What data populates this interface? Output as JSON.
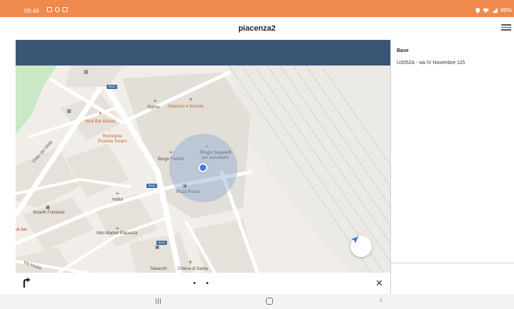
{
  "status_bar": {
    "time": "09:48",
    "battery": "99%",
    "bg_color": "#ee8a4e"
  },
  "app": {
    "title": "piacenza2",
    "menu_icon": "hamburger-menu-icon",
    "header_color": "#3b5575"
  },
  "map": {
    "labels": {
      "sigma": "Sigma",
      "deposito": "Deposito e ferrovia",
      "new_bar": "New Bar Kebab",
      "ristorante": "Ristorante Pizzeria Tevaro",
      "borgo": "Borgo Faxhall",
      "rifugio": "Rifugio Segadelli per senzatetto",
      "pizza": "Pizza Rosso",
      "hello": "Hello!",
      "smarth": "Smarth Furniture",
      "mini": "Mini Market Piacenza",
      "tabacchi": "Tabacchi",
      "chiesa": "Chiesa di Santa",
      "viale": "Viale dei Mille",
      "via_ma": "Via Madai",
      "kbar": "ck bar"
    },
    "shields": [
      "SS10",
      "SS10",
      "SS10"
    ],
    "recenter_icon": "navigation-arrow-icon"
  },
  "bottom_bar": {
    "direction_icon": "turn-direction-icon",
    "close_icon": "close-icon"
  },
  "side_panel": {
    "heading": "Base",
    "stop": "U3052A - via IV Novembre 115"
  }
}
